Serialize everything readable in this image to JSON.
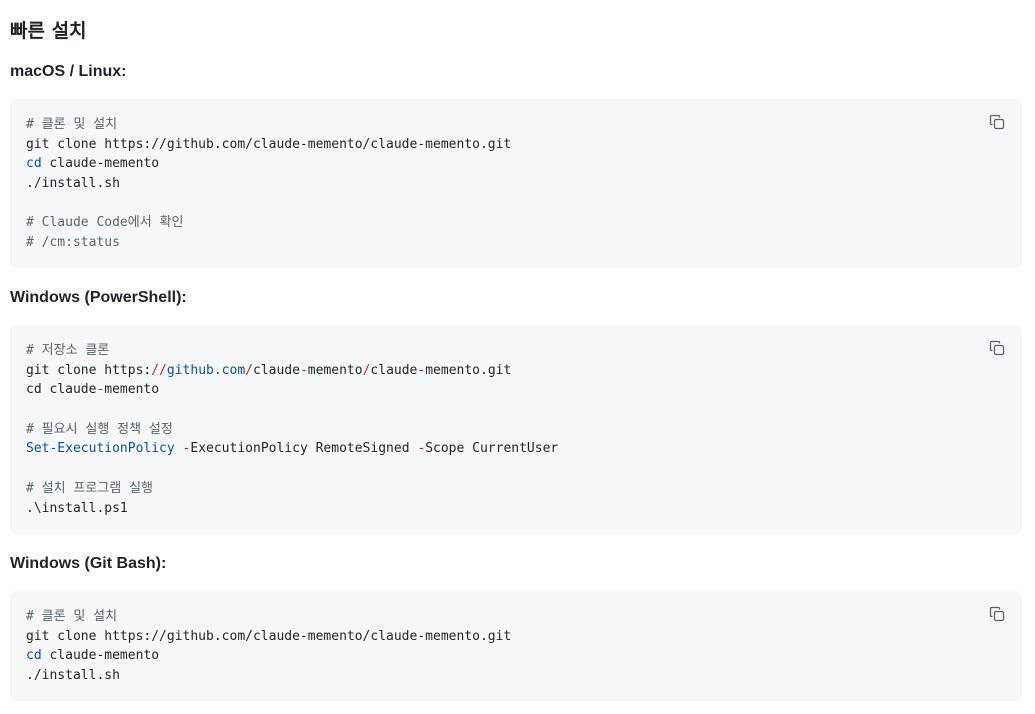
{
  "title": "빠른 설치",
  "sections": [
    {
      "heading": "macOS / Linux:",
      "lines": [
        [
          {
            "t": "# 클론 및 설치",
            "c": "comment"
          }
        ],
        [
          {
            "t": "git clone https://github.com/claude-memento/claude-memento.git",
            "c": ""
          }
        ],
        [
          {
            "t": "cd",
            "c": "cmd"
          },
          {
            "t": " claude-memento",
            "c": ""
          }
        ],
        [
          {
            "t": "./install.sh",
            "c": ""
          }
        ],
        [],
        [
          {
            "t": "# Claude Code에서 확인",
            "c": "comment"
          }
        ],
        [
          {
            "t": "# /cm:status",
            "c": "comment"
          }
        ]
      ]
    },
    {
      "heading": "Windows (PowerShell):",
      "lines": [
        [
          {
            "t": "# 저장소 클론",
            "c": "comment"
          }
        ],
        [
          {
            "t": "git clone https:",
            "c": ""
          },
          {
            "t": "//",
            "c": "op"
          },
          {
            "t": "github.com",
            "c": "url"
          },
          {
            "t": "/",
            "c": "op"
          },
          {
            "t": "claude",
            "c": ""
          },
          {
            "t": "-",
            "c": "op"
          },
          {
            "t": "memento",
            "c": ""
          },
          {
            "t": "/",
            "c": "op"
          },
          {
            "t": "claude",
            "c": ""
          },
          {
            "t": "-",
            "c": "op"
          },
          {
            "t": "memento.git",
            "c": ""
          }
        ],
        [
          {
            "t": "cd claude",
            "c": ""
          },
          {
            "t": "-",
            "c": "op"
          },
          {
            "t": "memento",
            "c": ""
          }
        ],
        [],
        [
          {
            "t": "# 필요시 실행 정책 설정",
            "c": "comment"
          }
        ],
        [
          {
            "t": "Set-ExecutionPolicy",
            "c": "cmd"
          },
          {
            "t": " ",
            "c": ""
          },
          {
            "t": "-",
            "c": "op"
          },
          {
            "t": "ExecutionPolicy RemoteSigned ",
            "c": ""
          },
          {
            "t": "-",
            "c": "op"
          },
          {
            "t": "Scope CurrentUser",
            "c": ""
          }
        ],
        [],
        [
          {
            "t": "# 설치 프로그램 실행",
            "c": "comment"
          }
        ],
        [
          {
            "t": ".\\install.ps1",
            "c": ""
          }
        ]
      ]
    },
    {
      "heading": "Windows (Git Bash):",
      "lines": [
        [
          {
            "t": "# 클론 및 설치",
            "c": "comment"
          }
        ],
        [
          {
            "t": "git clone https://github.com/claude-memento/claude-memento.git",
            "c": ""
          }
        ],
        [
          {
            "t": "cd",
            "c": "cmd"
          },
          {
            "t": " claude-memento",
            "c": ""
          }
        ],
        [
          {
            "t": "./install.sh",
            "c": ""
          }
        ]
      ]
    }
  ],
  "icons": {
    "copy": "copy-icon"
  },
  "colors": {
    "code_bg": "#f6f8fa",
    "comment": "#59636e",
    "keyword": "#0550ae",
    "operator": "#cf222e"
  }
}
